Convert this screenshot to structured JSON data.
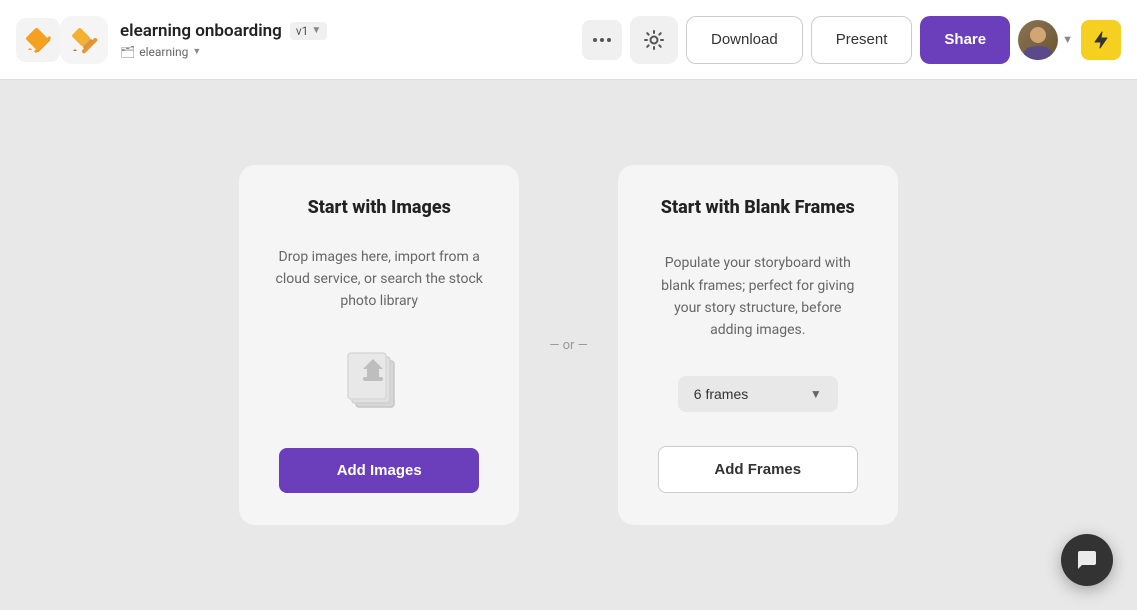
{
  "header": {
    "project_title": "elearning onboarding",
    "version": "v1",
    "breadcrumb": "elearning",
    "more_label": "...",
    "download_label": "Download",
    "present_label": "Present",
    "share_label": "Share"
  },
  "divider": {
    "text": "— or —"
  },
  "left_card": {
    "title_start": "Start with ",
    "title_bold": "Images",
    "description": "Drop images here, import from a cloud service, or search the stock photo library",
    "button_label": "Add Images"
  },
  "right_card": {
    "title_start": "Start with ",
    "title_bold": "Blank Frames",
    "description": "Populate your storyboard with blank frames; perfect for giving your story structure, before adding images.",
    "frames_option": "6 frames",
    "button_label": "Add Frames"
  },
  "lightning_icon": "⚡",
  "chat_icon": "💬"
}
